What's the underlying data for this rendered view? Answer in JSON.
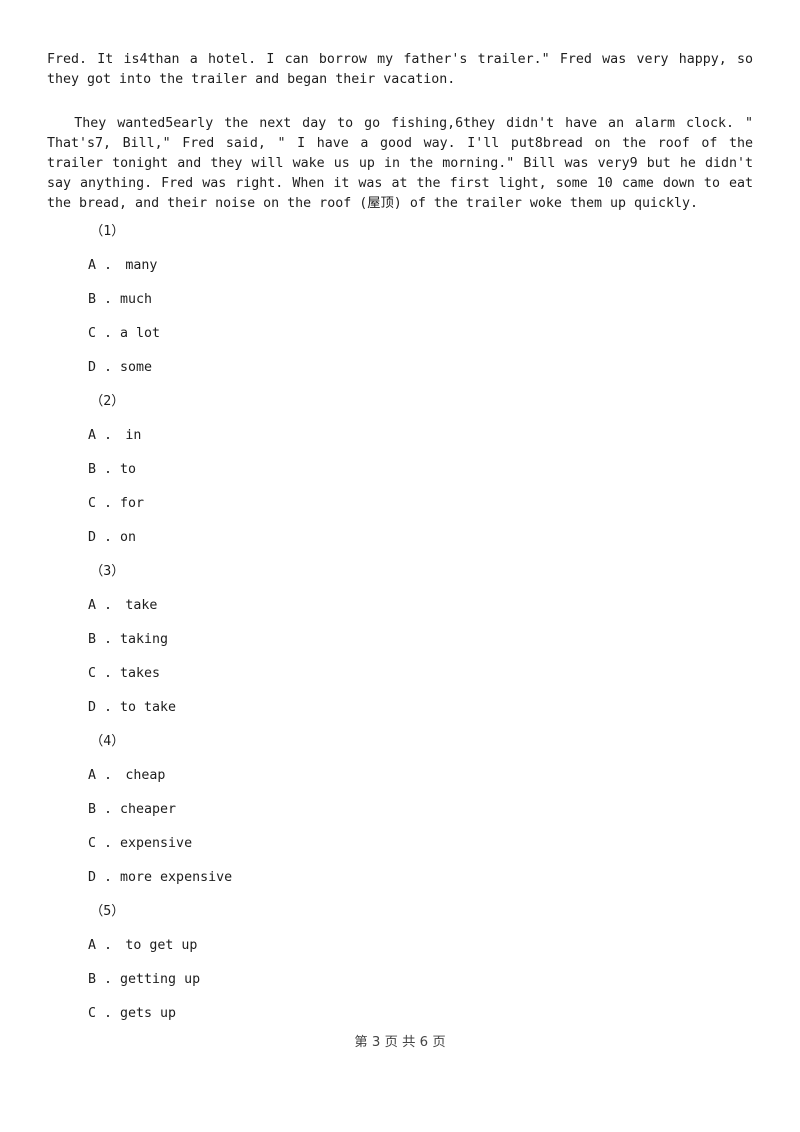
{
  "document": {
    "passage": {
      "paragraph_1": "Fred. It is4than a hotel. I can borrow my father's trailer.\" Fred was very happy, so they got into the trailer and began their vacation.",
      "paragraph_2": "They wanted5early the next day to go fishing,6they didn't have an alarm clock. \" That's7, Bill,\" Fred said, \" I have a good way. I'll put8bread on the roof of the trailer tonight and they will wake us up in the morning.\" Bill was very9 but he didn't say anything. Fred was right. When it was at the first light, some 10 came down to eat the bread, and their noise on the roof (屋顶) of the trailer woke them up quickly."
    },
    "questions": [
      {
        "number": "（1）",
        "options": [
          "A .　many",
          "B . much",
          "C . a lot",
          "D . some"
        ]
      },
      {
        "number": "（2）",
        "options": [
          "A .　in",
          "B . to",
          "C . for",
          "D . on"
        ]
      },
      {
        "number": "（3）",
        "options": [
          "A .　take",
          "B . taking",
          "C . takes",
          "D . to take"
        ]
      },
      {
        "number": "（4）",
        "options": [
          "A .　cheap",
          "B . cheaper",
          "C . expensive",
          "D . more expensive"
        ]
      },
      {
        "number": "（5）",
        "options": [
          "A .　to get up",
          "B . getting up",
          "C . gets up"
        ]
      }
    ],
    "footer": {
      "page_label": "第 3 页 共 6 页",
      "current_page": "3",
      "total_pages": "6"
    },
    "colors": {
      "background": "#ffffff",
      "text": "#1d1d1d",
      "footer_text": "#444444"
    }
  }
}
